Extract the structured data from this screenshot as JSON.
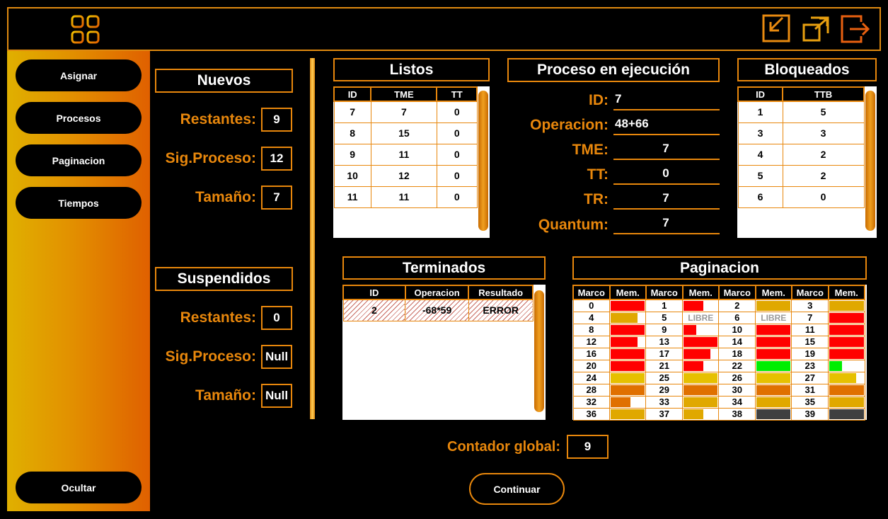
{
  "toolbar": {
    "icons": [
      "apps-icon",
      "minimize-icon",
      "maximize-icon",
      "exit-icon"
    ]
  },
  "sidebar": {
    "asignar": "Asignar",
    "procesos": "Procesos",
    "paginacion": "Paginacion",
    "tiempos": "Tiempos",
    "ocultar": "Ocultar"
  },
  "nuevos": {
    "title": "Nuevos",
    "restantes_label": "Restantes:",
    "restantes": "9",
    "sig_label": "Sig.Proceso:",
    "sig": "12",
    "tam_label": "Tamaño:",
    "tam": "7"
  },
  "suspendidos": {
    "title": "Suspendidos",
    "restantes_label": "Restantes:",
    "restantes": "0",
    "sig_label": "Sig.Proceso:",
    "sig": "Null",
    "tam_label": "Tamaño:",
    "tam": "Null"
  },
  "listos": {
    "title": "Listos",
    "headers": [
      "ID",
      "TME",
      "TT"
    ],
    "rows": [
      [
        "7",
        "7",
        "0"
      ],
      [
        "8",
        "15",
        "0"
      ],
      [
        "9",
        "11",
        "0"
      ],
      [
        "10",
        "12",
        "0"
      ],
      [
        "11",
        "11",
        "0"
      ]
    ]
  },
  "ejecucion": {
    "title": "Proceso en ejecución",
    "id_label": "ID:",
    "id": "7",
    "op_label": "Operacion:",
    "op": "48+66",
    "tme_label": "TME:",
    "tme": "7",
    "tt_label": "TT:",
    "tt": "0",
    "tr_label": "TR:",
    "tr": "7",
    "quantum_label": "Quantum:",
    "quantum": "7"
  },
  "bloqueados": {
    "title": "Bloqueados",
    "headers": [
      "ID",
      "TTB"
    ],
    "rows": [
      [
        "1",
        "5"
      ],
      [
        "3",
        "3"
      ],
      [
        "4",
        "2"
      ],
      [
        "5",
        "2"
      ],
      [
        "6",
        "0"
      ]
    ]
  },
  "terminados": {
    "title": "Terminados",
    "headers": [
      "ID",
      "Operacion",
      "Resultado"
    ],
    "rows": [
      [
        "2",
        "-68*59",
        "ERROR"
      ]
    ]
  },
  "paginacion": {
    "title": "Paginacion",
    "headers": [
      "Marco",
      "Mem.",
      "Marco",
      "Mem.",
      "Marco",
      "Mem.",
      "Marco",
      "Mem."
    ],
    "libre_text": "LIBRE",
    "colors": {
      "red": "#ff0000",
      "gold": "#e0a800",
      "orange": "#e07000",
      "yellow": "#e6c000",
      "green": "#00ee00",
      "gray": "#404040"
    },
    "frames": [
      {
        "n": "0",
        "c": "red",
        "f": 1
      },
      {
        "n": "1",
        "c": "red",
        "f": 0.6
      },
      {
        "n": "2",
        "c": "gold",
        "f": 1
      },
      {
        "n": "3",
        "c": "gold",
        "f": 1
      },
      {
        "n": "4",
        "c": "gold",
        "f": 0.8
      },
      {
        "n": "5",
        "libre": true
      },
      {
        "n": "6",
        "libre": true
      },
      {
        "n": "7",
        "c": "red",
        "f": 1
      },
      {
        "n": "8",
        "c": "red",
        "f": 1
      },
      {
        "n": "9",
        "c": "red",
        "f": 0.4
      },
      {
        "n": "10",
        "c": "red",
        "f": 1
      },
      {
        "n": "11",
        "c": "red",
        "f": 1
      },
      {
        "n": "12",
        "c": "red",
        "f": 0.8
      },
      {
        "n": "13",
        "c": "red",
        "f": 1
      },
      {
        "n": "14",
        "c": "red",
        "f": 1
      },
      {
        "n": "15",
        "c": "red",
        "f": 1
      },
      {
        "n": "16",
        "c": "red",
        "f": 1
      },
      {
        "n": "17",
        "c": "red",
        "f": 0.8
      },
      {
        "n": "18",
        "c": "red",
        "f": 1
      },
      {
        "n": "19",
        "c": "red",
        "f": 1
      },
      {
        "n": "20",
        "c": "red",
        "f": 1
      },
      {
        "n": "21",
        "c": "red",
        "f": 0.6
      },
      {
        "n": "22",
        "c": "green",
        "f": 1
      },
      {
        "n": "23",
        "c": "green",
        "f": 0.4
      },
      {
        "n": "24",
        "c": "yellow",
        "f": 1
      },
      {
        "n": "25",
        "c": "yellow",
        "f": 1
      },
      {
        "n": "26",
        "c": "yellow",
        "f": 1
      },
      {
        "n": "27",
        "c": "yellow",
        "f": 0.8
      },
      {
        "n": "28",
        "c": "orange",
        "f": 1
      },
      {
        "n": "29",
        "c": "orange",
        "f": 1
      },
      {
        "n": "30",
        "c": "orange",
        "f": 1
      },
      {
        "n": "31",
        "c": "orange",
        "f": 1
      },
      {
        "n": "32",
        "c": "orange",
        "f": 0.6
      },
      {
        "n": "33",
        "c": "gold",
        "f": 1
      },
      {
        "n": "34",
        "c": "gold",
        "f": 1
      },
      {
        "n": "35",
        "c": "gold",
        "f": 1
      },
      {
        "n": "36",
        "c": "gold",
        "f": 1
      },
      {
        "n": "37",
        "c": "gold",
        "f": 0.6
      },
      {
        "n": "38",
        "c": "gray",
        "f": 1
      },
      {
        "n": "39",
        "c": "gray",
        "f": 1
      }
    ]
  },
  "contador": {
    "label": "Contador global:",
    "value": "9"
  },
  "continuar": "Continuar"
}
